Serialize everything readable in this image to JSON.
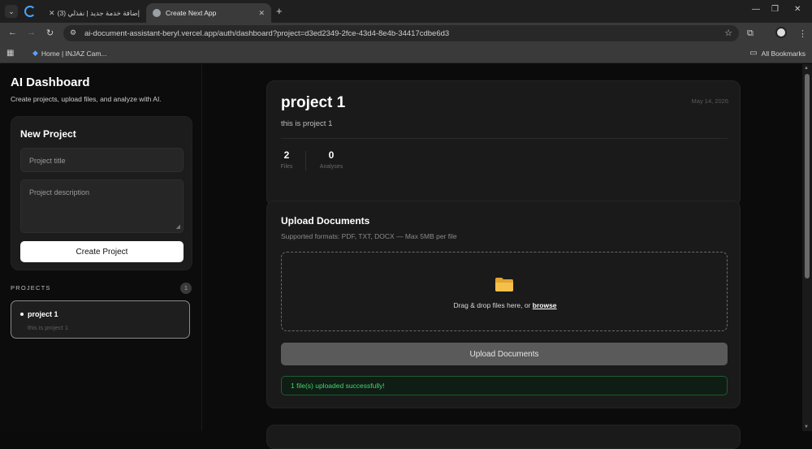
{
  "browser": {
    "tabs": [
      {
        "title": "إضافة خدمة جديد | نفذلي (3)"
      },
      {
        "title": "Create Next App"
      }
    ],
    "url": "ai-document-assistant-beryl.vercel.app/auth/dashboard?project=d3ed2349-2fce-43d4-8e4b-34417cdbe6d3",
    "bookmarks": [
      {
        "label": "Home | INJAZ Cam..."
      }
    ],
    "all_bookmarks": "All Bookmarks"
  },
  "sidebar": {
    "title": "AI Dashboard",
    "subtitle": "Create projects, upload files, and analyze with AI.",
    "new_project": {
      "heading": "New Project",
      "title_placeholder": "Project title",
      "description_placeholder": "Project description",
      "create_button": "Create Project"
    },
    "projects_label": "PROJECTS",
    "projects_count": "1",
    "projects": [
      {
        "name": "project 1",
        "description": "this is project 1"
      }
    ]
  },
  "project": {
    "title": "project 1",
    "date": "May 14, 2026",
    "description": "this is project 1",
    "stats": [
      {
        "value": "2",
        "label": "Files"
      },
      {
        "value": "0",
        "label": "Analyses"
      }
    ]
  },
  "upload": {
    "title": "Upload Documents",
    "subtitle": "Supported formats: PDF, TXT, DOCX — Max 5MB per file",
    "drop_text": "Drag & drop files here, or",
    "browse": "browse",
    "button": "Upload Documents",
    "success": "1 file(s) uploaded successfully!"
  },
  "colors": {
    "success": "#4ad36e",
    "folder": "#f5c04a"
  }
}
